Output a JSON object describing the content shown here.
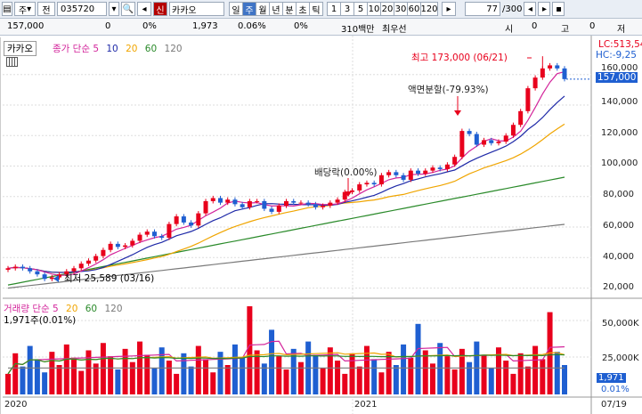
{
  "toolbar": {
    "menu": "주",
    "prefix": "전",
    "code": "035720",
    "badge": "신",
    "name": "카카오",
    "periods": [
      "일",
      "주",
      "월",
      "년",
      "분",
      "초",
      "틱"
    ],
    "active_period": "주",
    "intervals": [
      "1",
      "3",
      "5",
      "10",
      "20",
      "30",
      "60",
      "120"
    ],
    "count": "77",
    "total": "/300"
  },
  "quote": {
    "price": "157,000",
    "change": "0",
    "change_pct": "0%",
    "volume": "1,973",
    "vol_pct": "0.06%",
    "zero_pct": "0%",
    "amount": "310백만",
    "pref": "최우선",
    "o_lbl": "시",
    "o_val": "0",
    "h_lbl": "고",
    "h_val": "0",
    "l_lbl": "저"
  },
  "price_panel": {
    "tag": "카카오",
    "legend": "종가 단순",
    "p1": "5",
    "p2": "10",
    "p3": "20",
    "p4": "60",
    "p5": "120",
    "yticks": [
      "160,000",
      "140,000",
      "120,000",
      "100,000",
      "80,000",
      "60,000",
      "40,000",
      "20,000"
    ],
    "lc": "LC:513,54",
    "hc": "HC:-9,25",
    "cur": "157,000",
    "ann_high": "최고 173,000 (06/21)",
    "ann_low": "최저 25,589 (03/16)",
    "ann_split": "액면분할(-79.93%)",
    "ann_div": "배당락(0.00%)"
  },
  "vol_panel": {
    "legend": "거래량 단순",
    "p1": "5",
    "p2": "20",
    "p3": "60",
    "p4": "120",
    "sub": "1,971주(0.01%)",
    "yticks": [
      "50,000K",
      "25,000K"
    ],
    "cur": "1,971",
    "curpct": "0.01%"
  },
  "xaxis": {
    "t1": "2020",
    "t2": "2021",
    "t3": "07/19"
  },
  "colors": {
    "up": "#e8001c",
    "down": "#1f5fd1",
    "ma5": "#d3259b",
    "ma10": "#1f2aa8",
    "ma20": "#f0a500",
    "ma60": "#2a8a2a",
    "ma120": "#7a7a7a"
  },
  "chart_data": {
    "type": "candlestick",
    "close": [
      33,
      34,
      33,
      31,
      29,
      26,
      27,
      29,
      31,
      33,
      36,
      38,
      41,
      45,
      49,
      47,
      48,
      51,
      55,
      57,
      54,
      53,
      62,
      67,
      63,
      61,
      69,
      77,
      79,
      76,
      78,
      75,
      73,
      77,
      77,
      72,
      70,
      74,
      77,
      76,
      76,
      75,
      73,
      74,
      76,
      78,
      83,
      84,
      88,
      89,
      88,
      94,
      96,
      94,
      91,
      97,
      95,
      97,
      99,
      98,
      101,
      106,
      123,
      121,
      114,
      117,
      115,
      116,
      120,
      127,
      136,
      151,
      158,
      164,
      166,
      164,
      157
    ]
  }
}
